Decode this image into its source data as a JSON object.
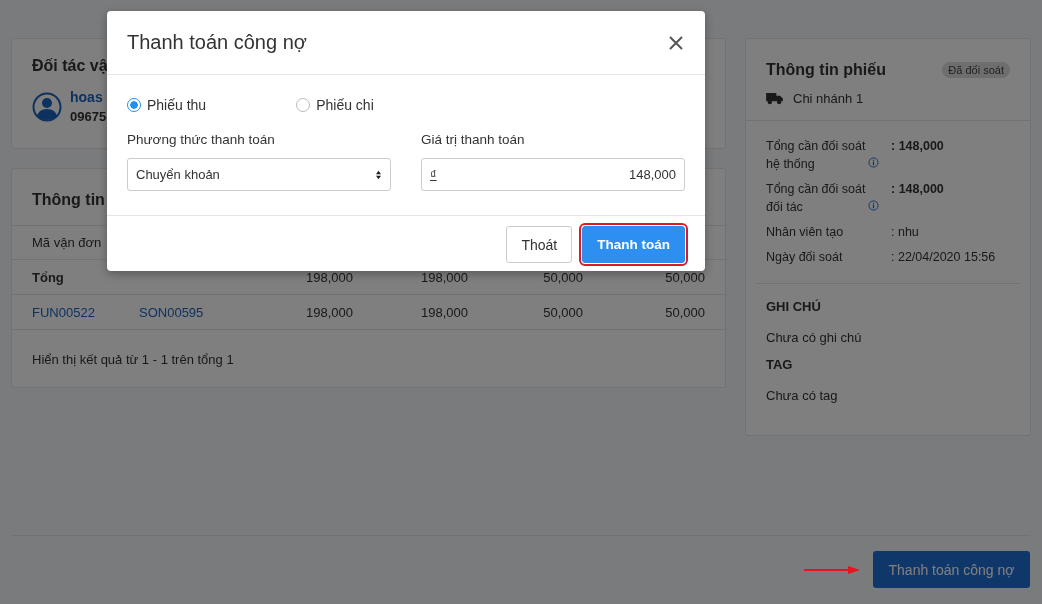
{
  "partner": {
    "heading": "Đối tác vậ",
    "name": "hoas",
    "phone": "09675"
  },
  "table": {
    "title": "Thông tin",
    "columns": [
      "Mã vận đơn"
    ],
    "total_row": {
      "label": "Tổng",
      "values": [
        "198,000",
        "198,000",
        "50,000",
        "50,000"
      ]
    },
    "rows": [
      {
        "cells": [
          "FUN00522",
          "SON00595",
          "198,000",
          "198,000",
          "50,000",
          "50,000"
        ]
      }
    ],
    "footer": "Hiển thị kết quả từ 1 - 1 trên tổng 1"
  },
  "receipt": {
    "title": "Thông tin phiếu",
    "status": "Đã đối soát",
    "branch": "Chi nhánh 1",
    "fields": [
      {
        "label": "Tổng cần đối soát hệ thống",
        "value": ": 148,000",
        "info": true,
        "bold": true
      },
      {
        "label": "Tổng cần đối soát đối tác",
        "value": ": 148,000",
        "info": true,
        "bold": true
      },
      {
        "label": "Nhân viên tạo",
        "value": ": nhu",
        "info": false,
        "bold": false
      },
      {
        "label": "Ngày đối soát",
        "value": ": 22/04/2020 15:56",
        "info": false,
        "bold": false
      }
    ],
    "note_heading": "GHI CHÚ",
    "note": "Chưa có ghi chú",
    "tag_heading": "TAG",
    "tag": "Chưa có tag"
  },
  "pay_debt_button": {
    "label": "Thanh toán công nợ",
    "pointed": true
  },
  "modal": {
    "title": "Thanh toán công nợ",
    "voucher_types": [
      {
        "label": "Phiếu thu",
        "selected": true
      },
      {
        "label": "Phiếu chi",
        "selected": false
      }
    ],
    "method": {
      "label": "Phương thức thanh toán",
      "value": "Chuyển khoản"
    },
    "amount": {
      "label": "Giá trị thanh toán",
      "currency": "₫",
      "value": "148,000"
    },
    "cancel_button": "Thoát",
    "submit_button": {
      "label": "Thanh toán",
      "highlighted": true
    }
  }
}
